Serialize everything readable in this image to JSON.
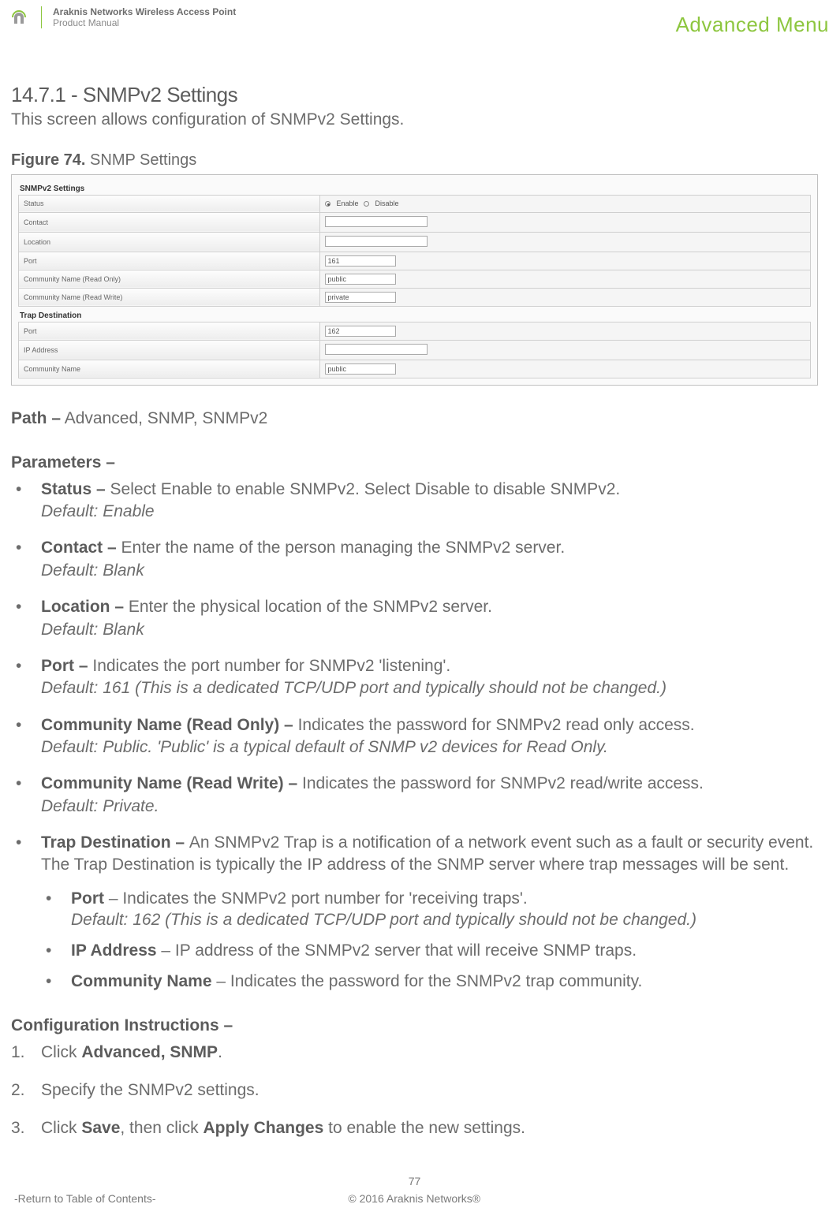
{
  "header": {
    "title": "Araknis Networks Wireless Access Point",
    "subtitle": "Product Manual",
    "advanced_menu": "Advanced Menu"
  },
  "section": {
    "title": "14.7.1 - SNMPv2 Settings",
    "intro": "This screen allows configuration of SNMPv2 Settings."
  },
  "figure": {
    "label_bold": "Figure 74.",
    "label_rest": "SNMP Settings"
  },
  "screenshot": {
    "group1": "SNMPv2 Settings",
    "rows1": [
      {
        "label": "Status",
        "type": "radio",
        "options": [
          "Enable",
          "Disable"
        ],
        "checked": 0
      },
      {
        "label": "Contact",
        "type": "input",
        "value": ""
      },
      {
        "label": "Location",
        "type": "input",
        "value": ""
      },
      {
        "label": "Port",
        "type": "input",
        "value": "161"
      },
      {
        "label": "Community Name (Read Only)",
        "type": "input",
        "value": "public"
      },
      {
        "label": "Community Name (Read Write)",
        "type": "input",
        "value": "private"
      }
    ],
    "group2": "Trap Destination",
    "rows2": [
      {
        "label": "Port",
        "type": "input",
        "value": "162"
      },
      {
        "label": "IP Address",
        "type": "input",
        "value": ""
      },
      {
        "label": "Community Name",
        "type": "input",
        "value": "public"
      }
    ]
  },
  "path": {
    "label": "Path –",
    "value": "Advanced, SNMP, SNMPv2"
  },
  "parameters": {
    "heading": "Parameters –",
    "items": [
      {
        "name": "Status – ",
        "desc": "Select Enable to enable SNMPv2. Select Disable to disable SNMPv2.",
        "default": "Default: Enable"
      },
      {
        "name": "Contact – ",
        "desc": "Enter the name of the person managing the SNMPv2 server.",
        "default": "Default: Blank"
      },
      {
        "name": "Location – ",
        "desc": "Enter the physical location of the SNMPv2 server.",
        "default": "Default: Blank"
      },
      {
        "name": "Port – ",
        "desc": "Indicates the port number for SNMPv2 'listening'.",
        "default": "Default: 161 (This is a dedicated TCP/UDP port and typically should not be changed.)"
      },
      {
        "name": "Community Name (Read Only) – ",
        "desc": "Indicates the password for SNMPv2 read only access.",
        "default": "Default: Public. 'Public' is a typical default of SNMP v2 devices for Read Only."
      },
      {
        "name": "Community Name (Read Write) – ",
        "desc": "Indicates the password for SNMPv2 read/write access.",
        "default": "Default: Private."
      },
      {
        "name": "Trap Destination – ",
        "desc": "An SNMPv2 Trap is a notification of a network event such as a fault or security event. The Trap Destination is typically the IP address of the SNMP server where trap messages will be sent.",
        "sub": [
          {
            "name": "Port",
            "desc": " – Indicates the SNMPv2 port number for 'receiving traps'.",
            "default": "Default: 162 (This is a dedicated TCP/UDP port and typically should not be changed.)"
          },
          {
            "name": "IP Address",
            "desc": " – IP address of the SNMPv2 server that will receive SNMP traps."
          },
          {
            "name": "Community Name",
            "desc": " – Indicates the password for the SNMPv2 trap community."
          }
        ]
      }
    ]
  },
  "config": {
    "heading": "Configuration Instructions –",
    "steps": [
      {
        "num": "1.",
        "pre": "Click ",
        "bold": "Advanced, SNMP",
        "post": "."
      },
      {
        "num": "2.",
        "pre": "Specify the SNMPv2 settings.",
        "bold": "",
        "post": ""
      },
      {
        "num": "3.",
        "pre": "Click ",
        "bold": "Save",
        "mid": ", then click ",
        "bold2": "Apply Changes",
        "post": " to enable the new settings."
      }
    ]
  },
  "footer": {
    "page": "77",
    "toc": "-Return to Table of Contents-",
    "copyright": "© 2016 Araknis Networks®"
  }
}
